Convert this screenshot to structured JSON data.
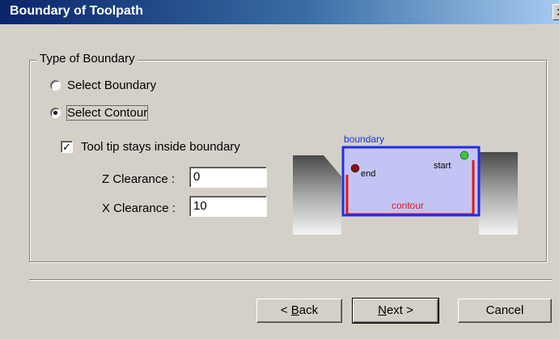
{
  "window": {
    "title": "Boundary of Toolpath",
    "close_glyph": "✕"
  },
  "group": {
    "label": "Type of Boundary",
    "options": [
      {
        "label": "Select Boundary",
        "checked": false
      },
      {
        "label": "Select Contour",
        "checked": true
      }
    ]
  },
  "tooltip_checkbox": {
    "label": "Tool tip stays inside boundary",
    "checked": true,
    "mark": "✓"
  },
  "fields": {
    "z_clearance": {
      "label": "Z Clearance :",
      "value": "0"
    },
    "x_clearance": {
      "label": "X Clearance :",
      "value": "10"
    }
  },
  "diagram": {
    "boundary_label": "boundary",
    "contour_label": "contour",
    "start_label": "start",
    "end_label": "end",
    "colors": {
      "boundary": "#1f2ee6",
      "contour": "#e01818",
      "fill": "#c4c4f4",
      "start": "#38c838",
      "end": "#8b1010"
    }
  },
  "buttons": {
    "back": {
      "mnemonic": "B",
      "rest": "ack",
      "prefix": "< "
    },
    "next": {
      "mnemonic": "N",
      "rest": "ext",
      "suffix": " >"
    },
    "cancel": {
      "label": "Cancel"
    }
  }
}
